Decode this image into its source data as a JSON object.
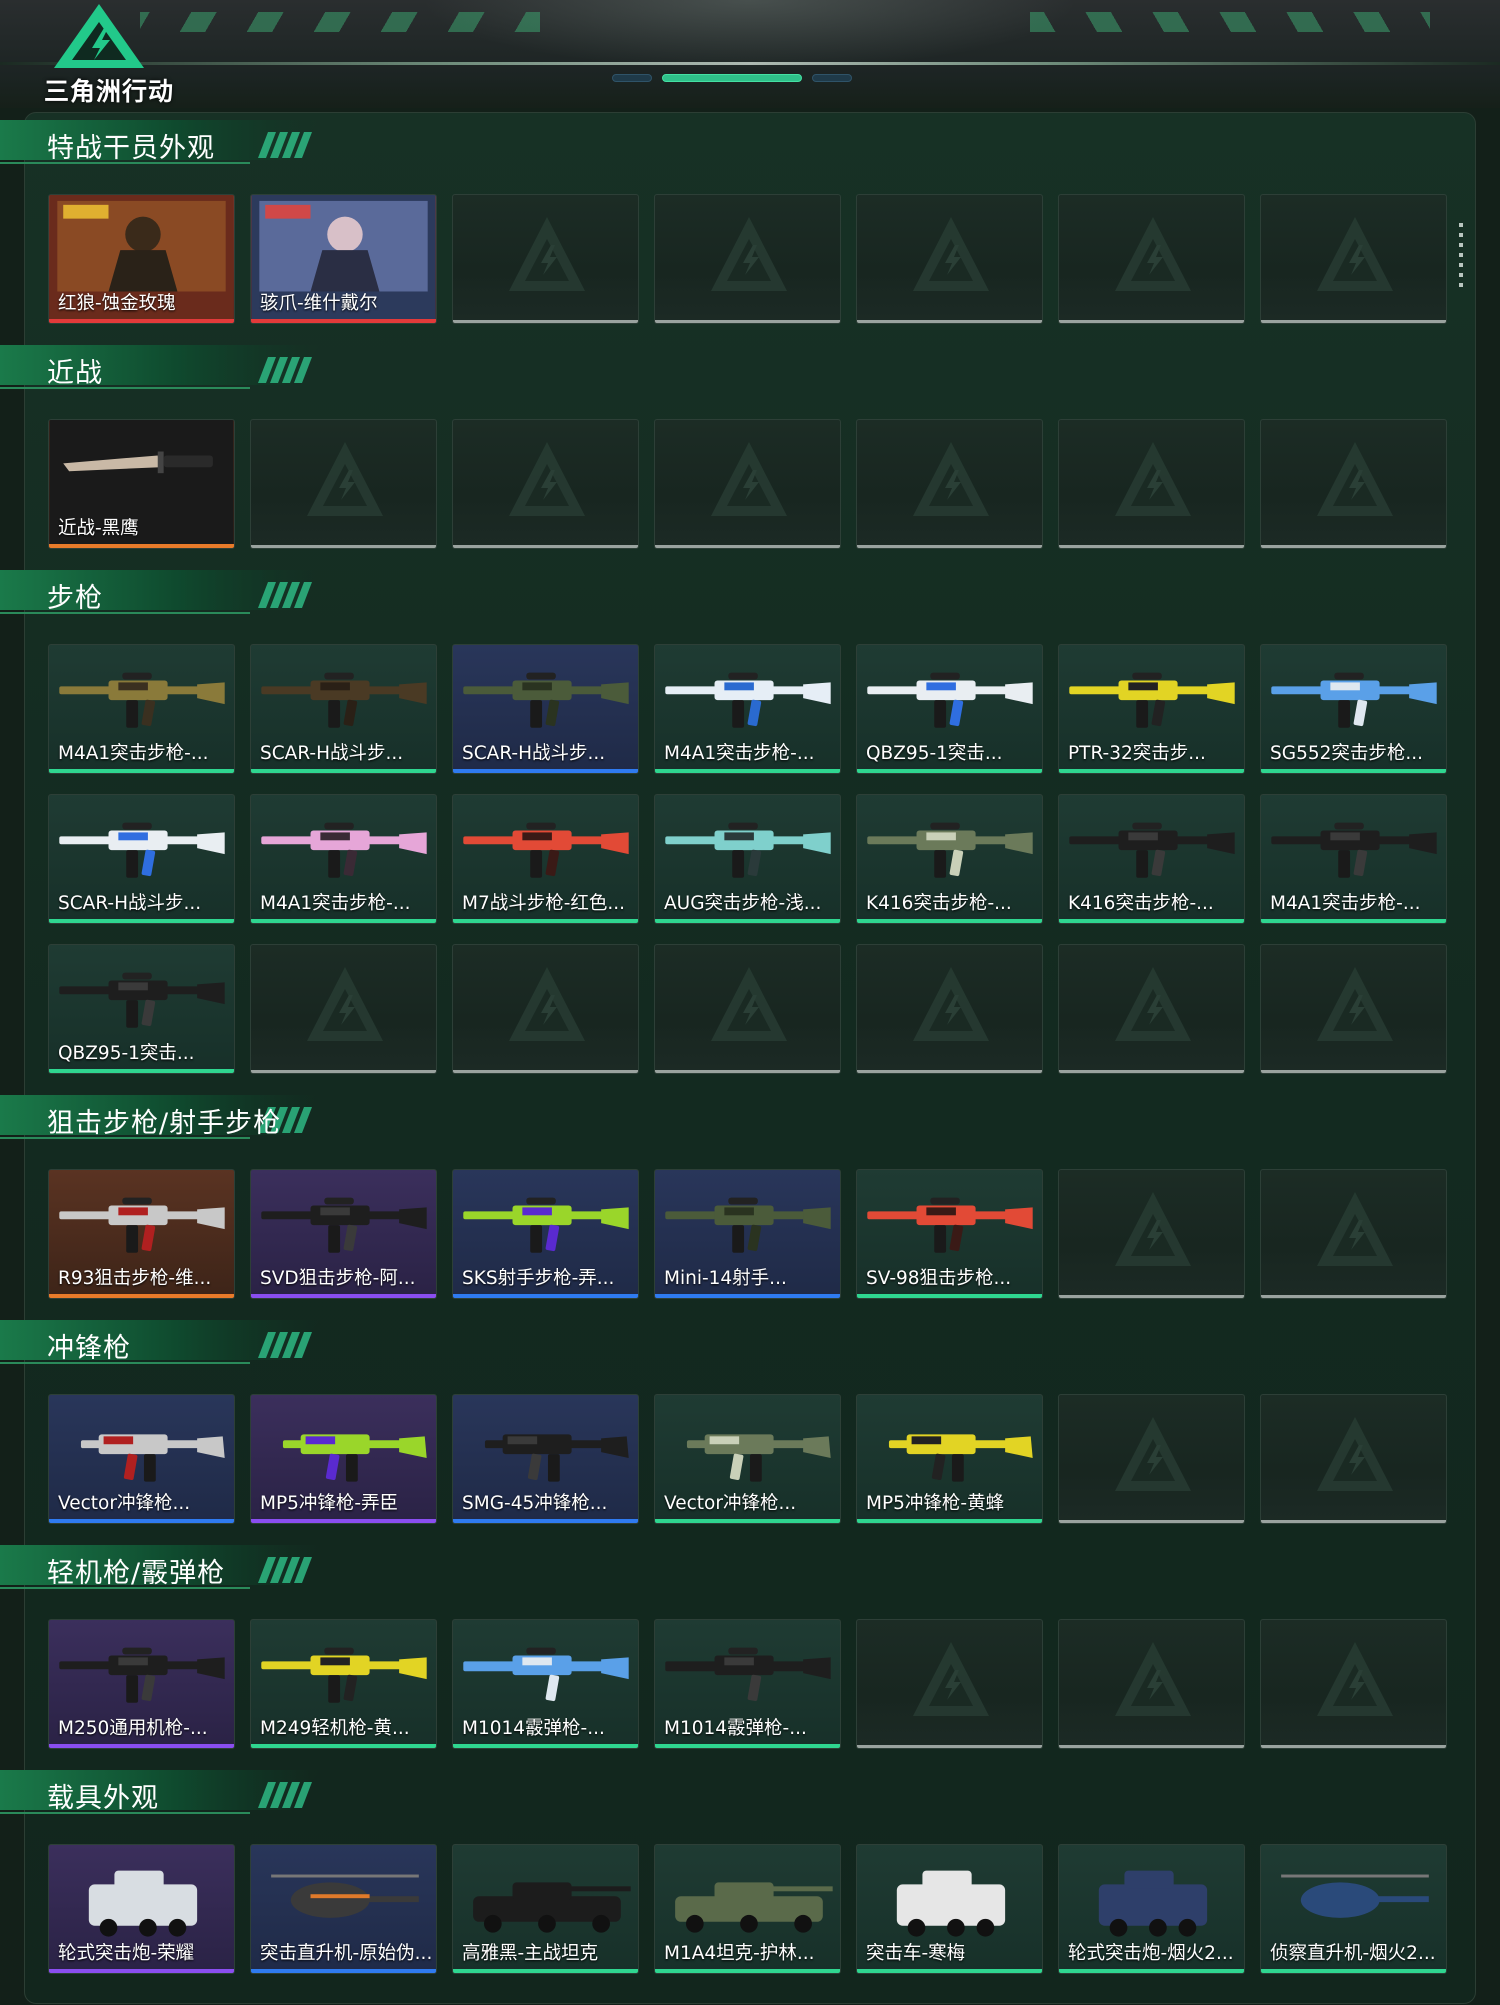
{
  "brand": {
    "logo_text": "三角洲行动"
  },
  "sections": [
    {
      "title": "特战干员外观",
      "items": [
        {
          "label": "红狼-蚀金玫瑰",
          "quality": "red",
          "icon": "operator-skin-image",
          "art": "operator-red"
        },
        {
          "label": "骇爪-维什戴尔",
          "quality": "red",
          "icon": "operator-skin-image",
          "art": "operator-blue"
        }
      ]
    },
    {
      "title": "近战",
      "items": [
        {
          "label": "近战-黑鹰",
          "quality": "orange",
          "icon": "knife-image",
          "art": "knife"
        }
      ]
    },
    {
      "title": "步枪",
      "items": [
        {
          "label": "M4A1突击步枪-...",
          "quality": "green",
          "icon": "rifle-image",
          "art": "rifle-gold"
        },
        {
          "label": "SCAR-H战斗步...",
          "quality": "green",
          "icon": "rifle-image",
          "art": "rifle-brown"
        },
        {
          "label": "SCAR-H战斗步...",
          "quality": "blue",
          "icon": "rifle-image",
          "art": "rifle-olive"
        },
        {
          "label": "M4A1突击步枪-...",
          "quality": "green",
          "icon": "rifle-image",
          "art": "rifle-bluewhite"
        },
        {
          "label": "QBZ95-1突击...",
          "quality": "green",
          "icon": "rifle-image",
          "art": "rifle-white"
        },
        {
          "label": "PTR-32突击步...",
          "quality": "green",
          "icon": "rifle-image",
          "art": "rifle-yellow"
        },
        {
          "label": "SG552突击步枪...",
          "quality": "green",
          "icon": "rifle-image",
          "art": "rifle-blue"
        },
        {
          "label": "SCAR-H战斗步...",
          "quality": "green",
          "icon": "rifle-image",
          "art": "rifle-white"
        },
        {
          "label": "M4A1突击步枪-...",
          "quality": "green",
          "icon": "rifle-image",
          "art": "rifle-pink"
        },
        {
          "label": "M7战斗步枪-红色...",
          "quality": "green",
          "icon": "rifle-image",
          "art": "rifle-red"
        },
        {
          "label": "AUG突击步枪-浅...",
          "quality": "green",
          "icon": "rifle-image",
          "art": "rifle-teal"
        },
        {
          "label": "K416突击步枪-...",
          "quality": "green",
          "icon": "rifle-image",
          "art": "rifle-camo"
        },
        {
          "label": "K416突击步枪-...",
          "quality": "green",
          "icon": "rifle-image",
          "art": "rifle-black"
        },
        {
          "label": "M4A1突击步枪-...",
          "quality": "green",
          "icon": "rifle-image",
          "art": "rifle-black"
        },
        {
          "label": "QBZ95-1突击...",
          "quality": "green",
          "icon": "rifle-image",
          "art": "rifle-black"
        }
      ]
    },
    {
      "title": "狙击步枪/射手步枪",
      "items": [
        {
          "label": "R93狙击步枪-维...",
          "quality": "orange",
          "icon": "sniper-image",
          "art": "rifle-redwhite"
        },
        {
          "label": "SVD狙击步枪-阿...",
          "quality": "purple",
          "icon": "sniper-image",
          "art": "rifle-black"
        },
        {
          "label": "SKS射手步枪-弄...",
          "quality": "blue",
          "icon": "sniper-image",
          "art": "rifle-lime"
        },
        {
          "label": "Mini-14射手...",
          "quality": "blue",
          "icon": "sniper-image",
          "art": "rifle-olive"
        },
        {
          "label": "SV-98狙击步枪...",
          "quality": "green",
          "icon": "sniper-image",
          "art": "rifle-red"
        }
      ]
    },
    {
      "title": "冲锋枪",
      "items": [
        {
          "label": "Vector冲锋枪...",
          "quality": "blue",
          "icon": "smg-image",
          "art": "smg-redwhite"
        },
        {
          "label": "MP5冲锋枪-弄臣",
          "quality": "purple",
          "icon": "smg-image",
          "art": "smg-lime"
        },
        {
          "label": "SMG-45冲锋枪...",
          "quality": "blue",
          "icon": "smg-image",
          "art": "smg-black"
        },
        {
          "label": "Vector冲锋枪...",
          "quality": "green",
          "icon": "smg-image",
          "art": "smg-camo"
        },
        {
          "label": "MP5冲锋枪-黄蜂",
          "quality": "green",
          "icon": "smg-image",
          "art": "smg-yellow"
        }
      ]
    },
    {
      "title": "轻机枪/霰弹枪",
      "items": [
        {
          "label": "M250通用机枪-...",
          "quality": "purple",
          "icon": "mg-image",
          "art": "rifle-black"
        },
        {
          "label": "M249轻机枪-黄...",
          "quality": "green",
          "icon": "mg-image",
          "art": "rifle-yellow"
        },
        {
          "label": "M1014霰弹枪-...",
          "quality": "green",
          "icon": "shotgun-image",
          "art": "shotgun-blue"
        },
        {
          "label": "M1014霰弹枪-...",
          "quality": "green",
          "icon": "shotgun-image",
          "art": "shotgun-black"
        }
      ]
    },
    {
      "title": "载具外观",
      "items": [
        {
          "label": "轮式突击炮-荣耀",
          "quality": "purple",
          "icon": "vehicle-image",
          "art": "vehicle-white"
        },
        {
          "label": "突击直升机-原始伪...",
          "quality": "blue",
          "icon": "helicopter-image",
          "art": "heli-orange"
        },
        {
          "label": "高雅黑-主战坦克",
          "quality": "green",
          "icon": "tank-image",
          "art": "tank-black"
        },
        {
          "label": "M1A4坦克-护林...",
          "quality": "green",
          "icon": "tank-image",
          "art": "tank-camo"
        },
        {
          "label": "突击车-寒梅",
          "quality": "green",
          "icon": "vehicle-image",
          "art": "vehicle-snow"
        },
        {
          "label": "轮式突击炮-烟火2...",
          "quality": "green",
          "icon": "vehicle-image",
          "art": "vehicle-blue"
        },
        {
          "label": "侦察直升机-烟火2...",
          "quality": "green",
          "icon": "helicopter-image",
          "art": "heli-blue"
        }
      ]
    }
  ],
  "colors": {
    "accent": "#2fc08a",
    "quality_red": "#e23a3a",
    "quality_orange": "#e87b2a",
    "quality_purple": "#8a4ef0",
    "quality_blue": "#2f7bf0",
    "quality_green": "#2fd690",
    "empty_bar": "#9aa39f"
  }
}
